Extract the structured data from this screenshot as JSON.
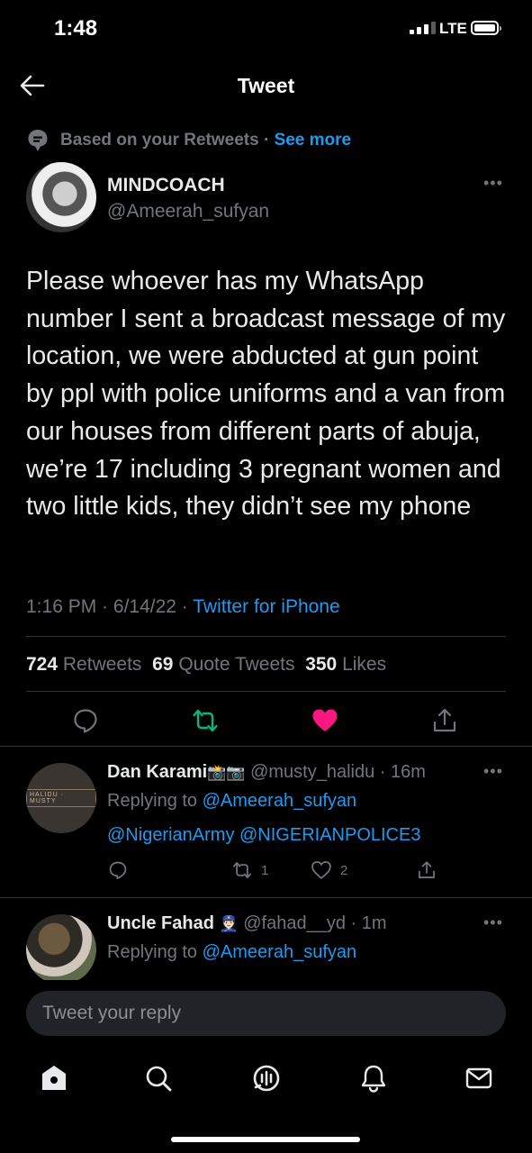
{
  "status_bar": {
    "time": "1:48",
    "network": "LTE"
  },
  "header": {
    "title": "Tweet"
  },
  "social_context": {
    "text": "Based on your Retweets",
    "separator": "·",
    "link": "See more"
  },
  "tweet": {
    "author_name": "MINDCOACH",
    "author_handle": "@Ameerah_sufyan",
    "text": "Please whoever has my WhatsApp number I sent a broadcast message of my location, we were abducted at gun point by ppl with police uniforms and a van from our houses from different parts of abuja, we’re 17 including 3 pregnant women and two little kids, they didn’t see my phone",
    "time": "1:16 PM",
    "date": "6/14/22",
    "source": "Twitter for iPhone",
    "retweets_count": "724",
    "retweets_label": "Retweets",
    "quotes_count": "69",
    "quotes_label": "Quote Tweets",
    "likes_count": "350",
    "likes_label": "Likes",
    "liked": true,
    "like_color": "#f91880",
    "retweet_color": "#00ba7c"
  },
  "replies": [
    {
      "name": "Dan Karami",
      "name_emoji": "📸📷",
      "handle": "@musty_halidu",
      "age": "16m",
      "replying_label": "Replying to",
      "replying_to": "@Ameerah_sufyan",
      "text": "@NigerianArmy @NIGERIANPOLICE3",
      "avatar_text": "HALIDU · MUSTY",
      "retweets": "1",
      "likes": "2"
    },
    {
      "name": "Uncle Fahad",
      "name_emoji": "👮🏻",
      "handle": "@fahad__yd",
      "age": "1m",
      "replying_label": "Replying to",
      "replying_to": "@Ameerah_sufyan"
    }
  ],
  "compose": {
    "placeholder": "Tweet your reply"
  },
  "tab_bar": {
    "icons": [
      "home-icon",
      "search-icon",
      "spaces-icon",
      "notifications-icon",
      "messages-icon"
    ]
  },
  "colors": {
    "accent": "#1d9bf0",
    "background": "#000000",
    "muted": "#71767b"
  }
}
